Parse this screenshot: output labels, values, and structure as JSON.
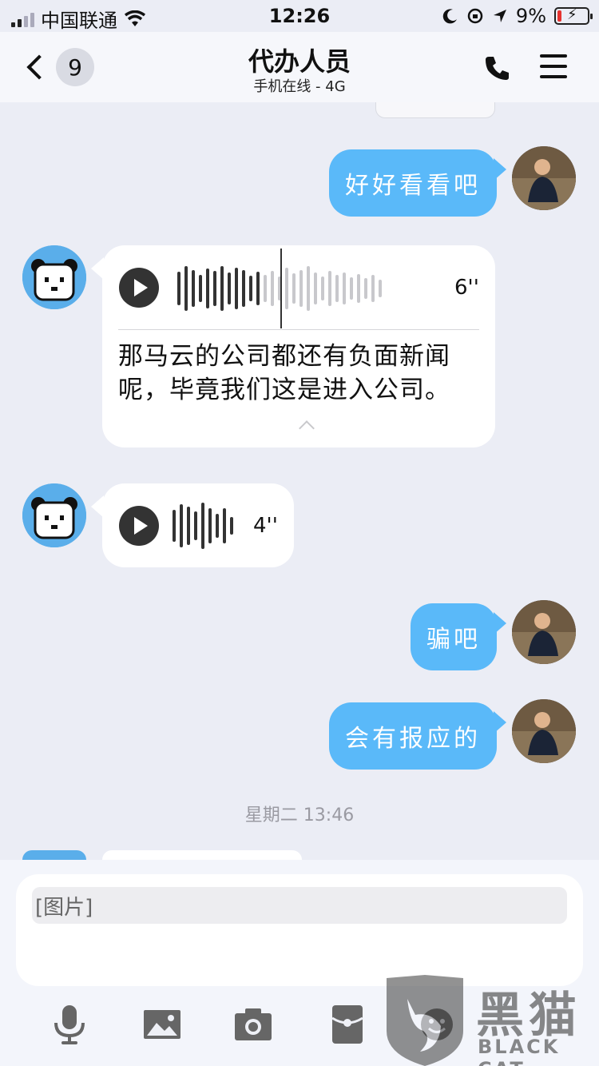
{
  "status_bar": {
    "carrier": "中国联通",
    "time": "12:26",
    "battery": "9%"
  },
  "nav": {
    "back_badge": "9",
    "title": "代办人员",
    "subtitle": "手机在线 - 4G"
  },
  "messages": [
    {
      "type": "text",
      "from": "me",
      "text": "好好看看吧"
    },
    {
      "type": "voice",
      "from": "contact",
      "duration": "6''",
      "transcript": [
        "那马云的公司都还有负面新闻",
        "呢，毕竟我们这是进入公司。"
      ]
    },
    {
      "type": "voice",
      "from": "contact",
      "duration": "4''"
    },
    {
      "type": "text",
      "from": "me",
      "text": "骗吧"
    },
    {
      "type": "text",
      "from": "me",
      "text": "会有报应的"
    }
  ],
  "timestamp": "星期二 13:46",
  "input": {
    "value": "[图片]"
  },
  "toolbar": [
    "mic-icon",
    "image-icon",
    "camera-icon",
    "red-packet-icon",
    "emoji-icon"
  ],
  "watermark": {
    "text": "黑猫",
    "sub": "BLACK CAT"
  },
  "colors": {
    "bubble_me": "#5ab9f9",
    "bubble_contact": "#ffffff",
    "background": "#ebedf5"
  }
}
